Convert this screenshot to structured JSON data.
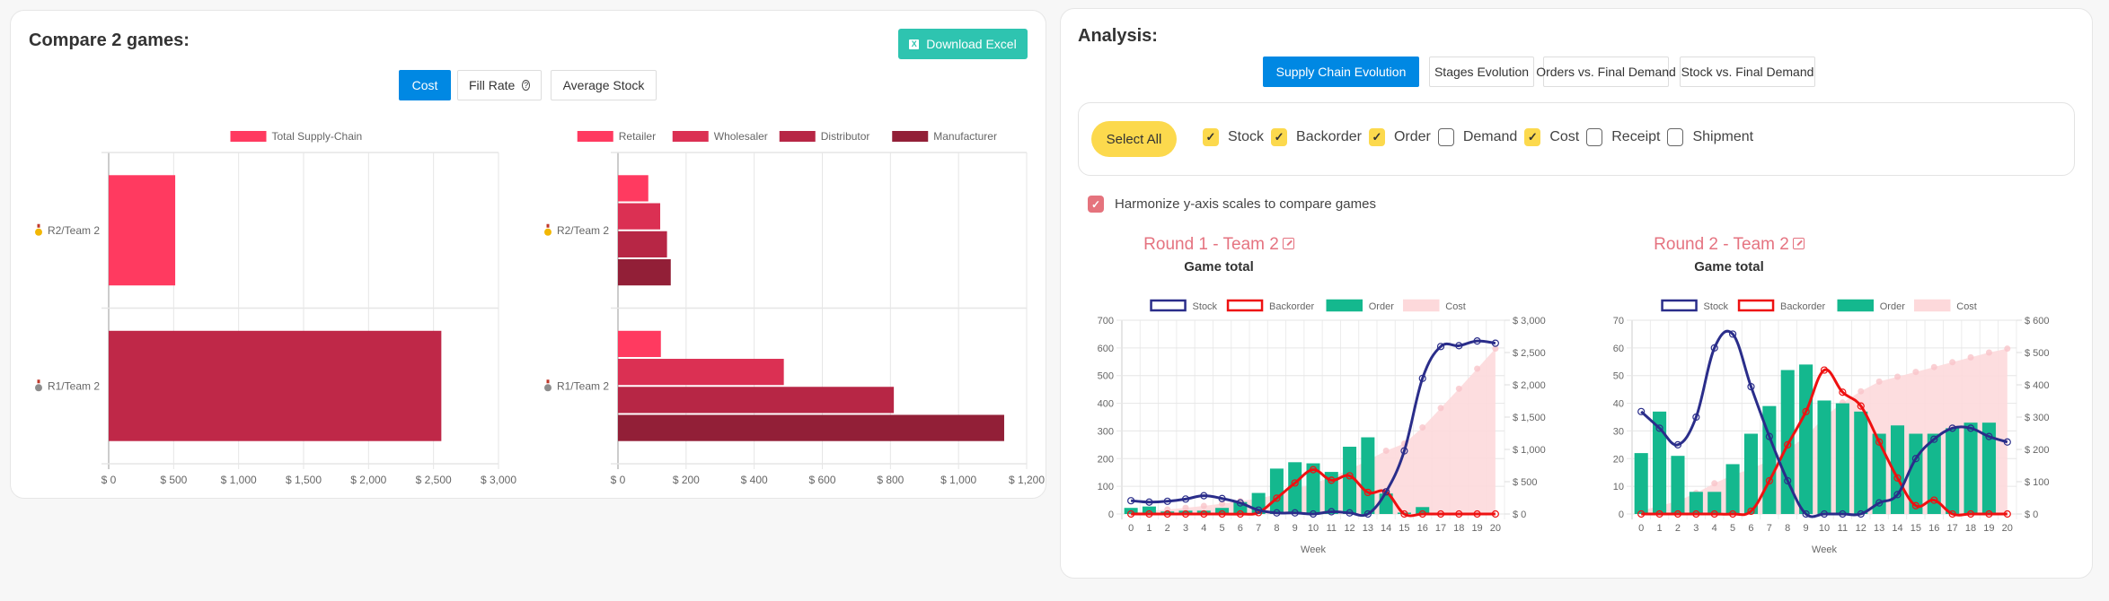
{
  "compare": {
    "title": "Compare 2 games:",
    "download_label": "Download Excel",
    "download_icon": "excel-icon",
    "tabs": [
      {
        "label": "Cost",
        "active": true
      },
      {
        "label": "Fill Rate",
        "active": false,
        "icon": "help-circle-icon"
      },
      {
        "label": "Average Stock",
        "active": false
      }
    ]
  },
  "analysis": {
    "title": "Analysis:",
    "tabs": [
      {
        "label": "Supply Chain Evolution",
        "active": true
      },
      {
        "label": "Stages Evolution",
        "active": false
      },
      {
        "label": "Orders vs. Final Demand",
        "active": false
      },
      {
        "label": "Stock vs. Final Demand",
        "active": false
      }
    ],
    "select_all_label": "Select All",
    "checkboxes": [
      {
        "label": "Stock",
        "checked": true
      },
      {
        "label": "Backorder",
        "checked": true
      },
      {
        "label": "Order",
        "checked": true
      },
      {
        "label": "Demand",
        "checked": false
      },
      {
        "label": "Cost",
        "checked": true
      },
      {
        "label": "Receipt",
        "checked": false
      },
      {
        "label": "Shipment",
        "checked": false
      }
    ],
    "harmonize_label": "Harmonize y-axis scales to compare games",
    "harmonize_checked": true,
    "games": [
      {
        "title": "Round 1 - Team 2",
        "subtitle": "Game total"
      },
      {
        "title": "Round 2 - Team 2",
        "subtitle": "Game total"
      }
    ]
  },
  "colors": {
    "primary": "#0088e3",
    "excel": "#2ec4b0",
    "yellow": "#fcd94d",
    "accent_red": "#e57380",
    "stock": "#2a2d8a",
    "backorder": "#ee1111",
    "order": "#14b88e",
    "cost": "#fdd9db",
    "retailer": "#ff3a60",
    "wholesaler": "#db3053",
    "distributor": "#b72645",
    "manufacturer": "#921f37",
    "r1_total": "#bf2848"
  },
  "chart_data": [
    {
      "type": "bar",
      "orientation": "horizontal",
      "title": "",
      "legend": [
        "Total Supply-Chain"
      ],
      "legend_position": "top",
      "categories": [
        {
          "label": "R2/Team 2",
          "medal": "gold-medal-icon"
        },
        {
          "label": "R1/Team 2",
          "medal": "silver-medal-icon"
        }
      ],
      "series": [
        {
          "name": "Total Supply-Chain",
          "values": [
            512,
            2560
          ]
        }
      ],
      "xlim": [
        0,
        3000
      ],
      "xticks": [
        "$ 0",
        "$ 500",
        "$ 1,000",
        "$ 1,500",
        "$ 2,000",
        "$ 2,500",
        "$ 3,000"
      ],
      "xtick_values": [
        0,
        500,
        1000,
        1500,
        2000,
        2500,
        3000
      ],
      "grid": true
    },
    {
      "type": "bar",
      "orientation": "horizontal",
      "title": "",
      "legend_position": "top",
      "categories": [
        {
          "label": "R2/Team 2",
          "medal": "gold-medal-icon"
        },
        {
          "label": "R1/Team 2",
          "medal": "silver-medal-icon"
        }
      ],
      "series": [
        {
          "name": "Retailer",
          "values": [
            89,
            126
          ]
        },
        {
          "name": "Wholesaler",
          "values": [
            124,
            487
          ]
        },
        {
          "name": "Distributor",
          "values": [
            144,
            810
          ]
        },
        {
          "name": "Manufacturer",
          "values": [
            155,
            1134
          ]
        }
      ],
      "xlim": [
        0,
        1200
      ],
      "xticks": [
        "$ 0",
        "$ 200",
        "$ 400",
        "$ 600",
        "$ 800",
        "$ 1,000",
        "$ 1,200"
      ],
      "xtick_values": [
        0,
        200,
        400,
        600,
        800,
        1000,
        1200
      ],
      "grid": true
    },
    {
      "type": "line",
      "title": "Round 1 - Team 2",
      "subtitle": "Game total",
      "xlabel": "Week",
      "x": [
        0,
        1,
        2,
        3,
        4,
        5,
        6,
        7,
        8,
        9,
        10,
        11,
        12,
        13,
        14,
        15,
        16,
        17,
        18,
        19,
        20
      ],
      "legend": [
        "Stock",
        "Backorder",
        "Order",
        "Cost"
      ],
      "legend_position": "top",
      "ylim": [
        0,
        700
      ],
      "yticks": [
        0,
        100,
        200,
        300,
        400,
        500,
        600,
        700
      ],
      "y2lim": [
        0,
        3000
      ],
      "y2ticks": [
        "$ 0",
        "$ 500",
        "$ 1,000",
        "$ 1,500",
        "$ 2,000",
        "$ 2,500",
        "$ 3,000"
      ],
      "y2tick_values": [
        0,
        500,
        1000,
        1500,
        2000,
        2500,
        3000
      ],
      "series": [
        {
          "name": "Stock",
          "kind": "line",
          "axis": "left",
          "values": [
            48,
            43,
            46,
            54,
            66,
            56,
            40,
            14,
            4,
            4,
            0,
            8,
            4,
            0,
            80,
            228,
            490,
            605,
            608,
            625,
            617
          ]
        },
        {
          "name": "Backorder",
          "kind": "line",
          "axis": "left",
          "values": [
            0,
            0,
            0,
            0,
            0,
            0,
            0,
            5,
            57,
            112,
            160,
            122,
            138,
            78,
            80,
            0,
            0,
            0,
            0,
            0,
            0
          ]
        },
        {
          "name": "Order",
          "kind": "bar",
          "axis": "left",
          "values": [
            22,
            27,
            9,
            12,
            12,
            22,
            43,
            76,
            164,
            187,
            183,
            152,
            243,
            277,
            74,
            5,
            25,
            0,
            0,
            0,
            0
          ]
        },
        {
          "name": "Cost",
          "kind": "area",
          "axis": "right",
          "values": [
            25,
            45,
            70,
            95,
            125,
            160,
            200,
            240,
            300,
            380,
            470,
            570,
            690,
            830,
            980,
            1090,
            1340,
            1640,
            1940,
            2250,
            2560
          ]
        }
      ],
      "grid": true
    },
    {
      "type": "line",
      "title": "Round 2 - Team 2",
      "subtitle": "Game total",
      "xlabel": "Week",
      "x": [
        0,
        1,
        2,
        3,
        4,
        5,
        6,
        7,
        8,
        9,
        10,
        11,
        12,
        13,
        14,
        15,
        16,
        17,
        18,
        19,
        20
      ],
      "legend": [
        "Stock",
        "Backorder",
        "Order",
        "Cost"
      ],
      "legend_position": "top",
      "ylim": [
        0,
        70
      ],
      "yticks": [
        0,
        10,
        20,
        30,
        40,
        50,
        60,
        70
      ],
      "y2lim": [
        0,
        600
      ],
      "y2ticks": [
        "$ 0",
        "$ 100",
        "$ 200",
        "$ 300",
        "$ 400",
        "$ 500",
        "$ 600"
      ],
      "y2tick_values": [
        0,
        100,
        200,
        300,
        400,
        500,
        600
      ],
      "series": [
        {
          "name": "Stock",
          "kind": "line",
          "axis": "left",
          "values": [
            37,
            31,
            25,
            35,
            60,
            65,
            46,
            28,
            12,
            0,
            0,
            0,
            0,
            4,
            7,
            20,
            27,
            31,
            31,
            28,
            26
          ]
        },
        {
          "name": "Backorder",
          "kind": "line",
          "axis": "left",
          "values": [
            0,
            0,
            0,
            0,
            0,
            0,
            1,
            12,
            25,
            37,
            52,
            44,
            39,
            26,
            13,
            3,
            5,
            0,
            0,
            0,
            0
          ]
        },
        {
          "name": "Order",
          "kind": "bar",
          "axis": "left",
          "values": [
            22,
            37,
            21,
            8,
            8,
            18,
            29,
            39,
            52,
            54,
            41,
            40,
            37,
            29,
            32,
            29,
            29,
            31,
            33,
            33,
            0
          ]
        },
        {
          "name": "Cost",
          "kind": "area",
          "axis": "right",
          "values": [
            10,
            25,
            40,
            65,
            95,
            120,
            140,
            165,
            200,
            240,
            300,
            345,
            380,
            410,
            425,
            440,
            455,
            470,
            485,
            500,
            512
          ]
        }
      ],
      "grid": true
    }
  ]
}
